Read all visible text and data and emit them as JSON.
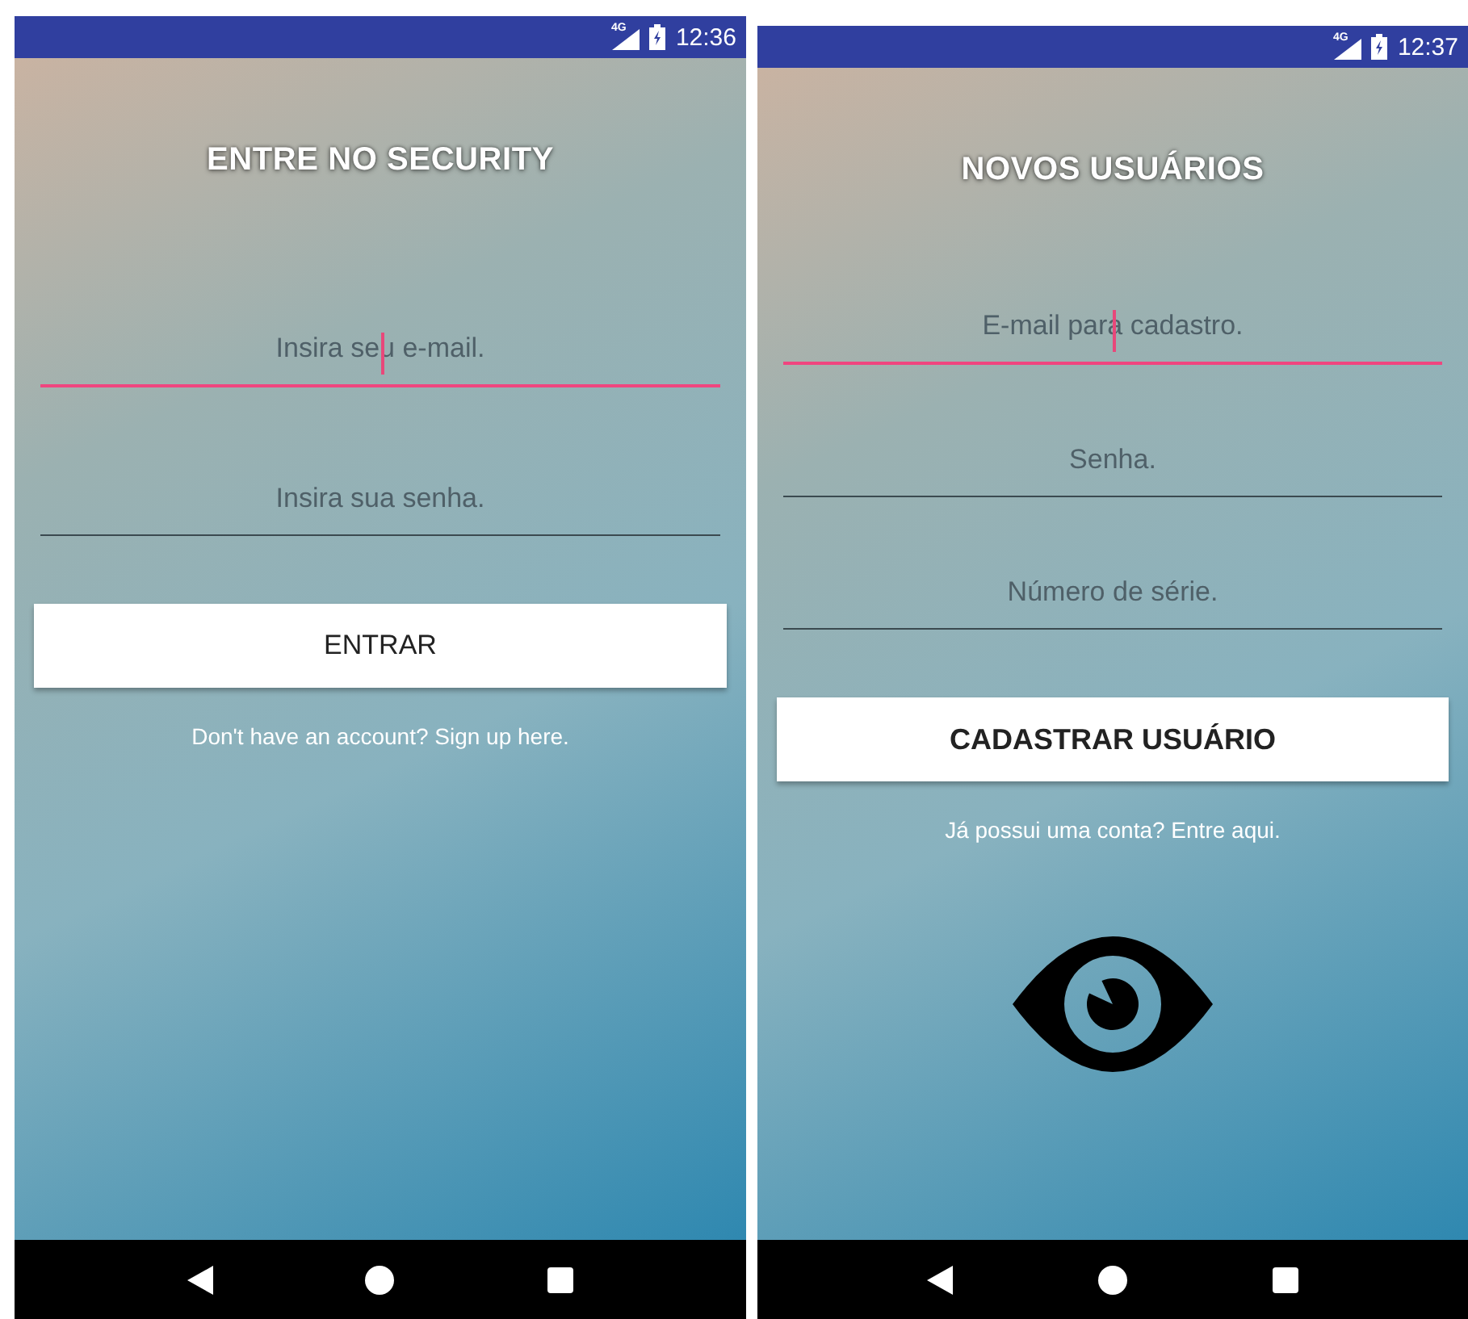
{
  "screens": [
    {
      "status_bar": {
        "network": "4G",
        "time": "12:36"
      },
      "title": "ENTRE NO SECURITY",
      "fields": [
        {
          "placeholder": "Insira seu e-mail.",
          "focused": true
        },
        {
          "placeholder": "Insira sua senha.",
          "focused": false
        }
      ],
      "button": "ENTRAR",
      "link": "Don't have an account? Sign up here.",
      "logo": false
    },
    {
      "status_bar": {
        "network": "4G",
        "time": "12:37"
      },
      "title": "NOVOS USUÁRIOS",
      "fields": [
        {
          "placeholder": "E-mail para cadastro.",
          "focused": true
        },
        {
          "placeholder": "Senha.",
          "focused": false
        },
        {
          "placeholder": "Número de série.",
          "focused": false
        }
      ],
      "button": "CADASTRAR USUÁRIO",
      "link": "Já possui uma conta? Entre aqui.",
      "logo": true
    }
  ]
}
